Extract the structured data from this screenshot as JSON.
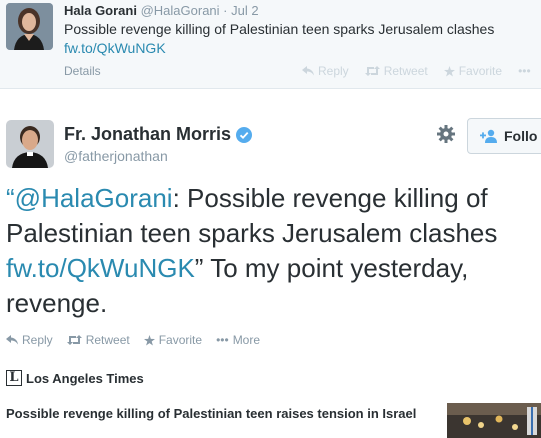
{
  "quoted_tweet": {
    "author_name": "Hala Gorani",
    "author_handle": "@HalaGorani",
    "separator": "·",
    "date": "Jul 2",
    "text": "Possible revenge killing of Palestinian teen sparks Jerusalem clashes",
    "link": "fw.to/QkWuNGK",
    "details_label": "Details",
    "actions": {
      "reply": "Reply",
      "retweet": "Retweet",
      "favorite": "Favorite",
      "more": "•••"
    },
    "avatar_icon": "avatar-woman-icon"
  },
  "main_tweet": {
    "author_name": "Fr. Jonathan Morris",
    "author_handle": "@fatherjonathan",
    "verified_icon": "verified-badge-icon",
    "follow_label": "Follo",
    "text": {
      "open_quote": "“",
      "mention": "@HalaGorani",
      "body": ": Possible revenge killing of Palestinian teen sparks Jerusalem clashes ",
      "link": "fw.to/QkWuNGK",
      "tail": "” To my point yesterday, revenge."
    },
    "actions": {
      "reply": "Reply",
      "retweet": "Retweet",
      "favorite": "Favorite",
      "more_dots": "•••",
      "more": "More"
    },
    "colors": {
      "link": "#2a8ab0",
      "verified": "#55acee"
    }
  },
  "card": {
    "source_name": "Los Angeles Times",
    "logo_letter": "L",
    "title": "Possible revenge killing of Palestinian teen raises tension in Israel"
  }
}
